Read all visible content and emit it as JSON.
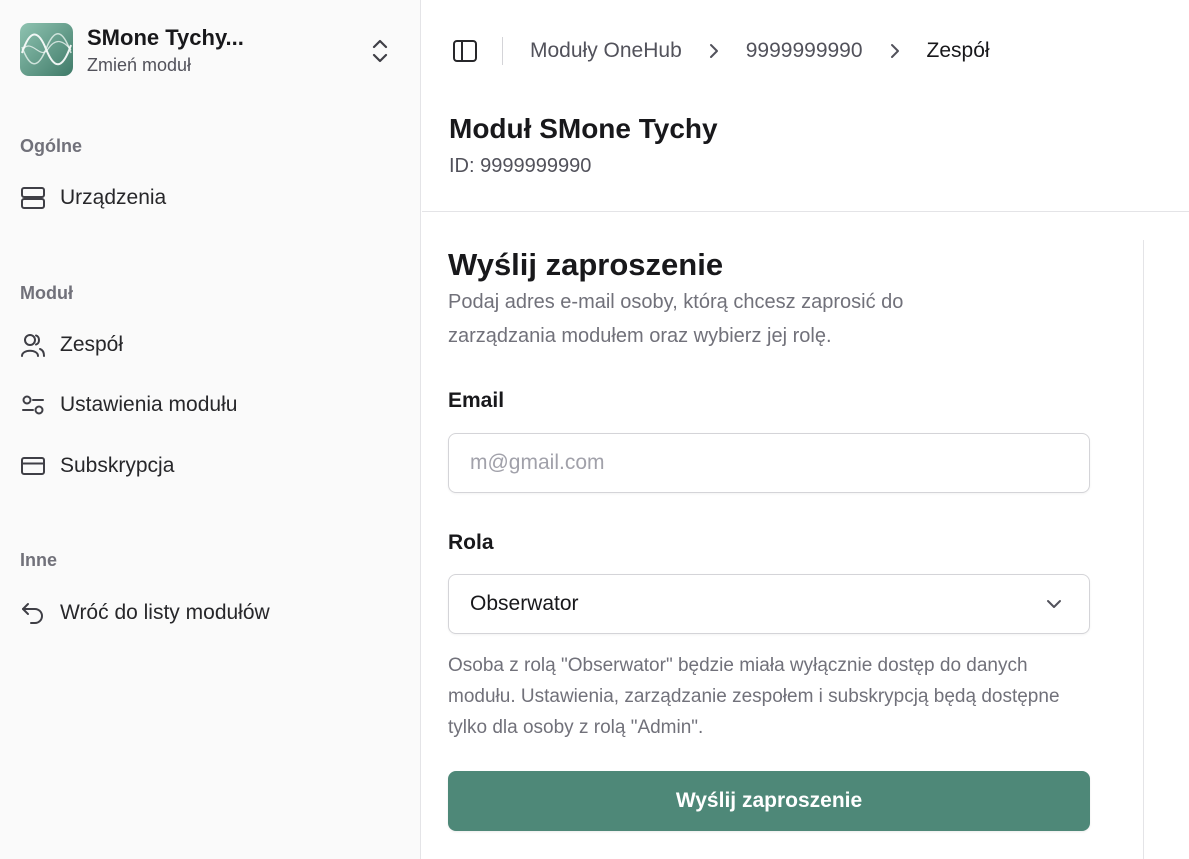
{
  "sidebar": {
    "module": {
      "title": "SMone Tychy...",
      "subtitle": "Zmień moduł",
      "logo_icon": "waveform-logo",
      "switch_icon": "chevrons-up-down-icon"
    },
    "groups": [
      {
        "label": "Ogólne",
        "items": [
          {
            "label": "Urządzenia",
            "icon": "server-icon"
          }
        ]
      },
      {
        "label": "Moduł",
        "items": [
          {
            "label": "Zespół",
            "icon": "users-icon"
          },
          {
            "label": "Ustawienia modułu",
            "icon": "settings-sliders-icon"
          },
          {
            "label": "Subskrypcja",
            "icon": "credit-card-icon"
          }
        ]
      },
      {
        "label": "Inne",
        "items": [
          {
            "label": "Wróć do listy modułów",
            "icon": "undo-arrow-icon"
          }
        ]
      }
    ]
  },
  "header": {
    "toggle_icon": "sidebar-toggle-icon",
    "breadcrumb": [
      "Moduły OneHub",
      "9999999990",
      "Zespół"
    ]
  },
  "page": {
    "title": "Moduł SMone Tychy",
    "id_text": "ID: 9999999990"
  },
  "invite_form": {
    "title": "Wyślij zaproszenie",
    "description": "Podaj adres e-mail osoby, którą chcesz zaprosić do zarządzania modułem oraz wybierz jej rolę.",
    "email_label": "Email",
    "email_placeholder": "m@gmail.com",
    "email_value": "",
    "role_label": "Rola",
    "role_value": "Obserwator",
    "role_hint": "Osoba z rolą \"Obserwator\" będzie miała wyłącznie dostęp do danych modułu. Ustawienia, zarządzanie zespołem i subskrypcją będą dostępne tylko dla osoby z rolą \"Admin\".",
    "submit_label": "Wyślij zaproszenie"
  },
  "colors": {
    "accent": "#4e8878",
    "sidebar_bg": "#fafafa",
    "muted_text": "#71717a"
  }
}
